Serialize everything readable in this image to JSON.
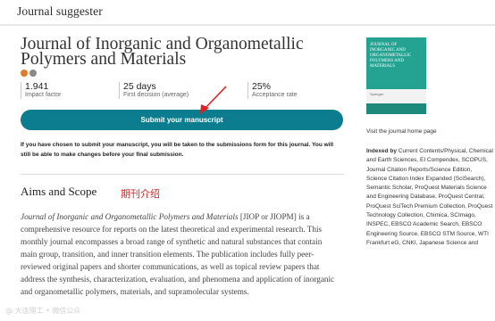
{
  "header": {
    "brand": "Journal suggester"
  },
  "journal": {
    "title": "Journal of Inorganic and Organometallic Polymers and Materials",
    "metrics": [
      {
        "value": "1.941",
        "label": "Impact factor"
      },
      {
        "value": "25 days",
        "label": "First decision (average)"
      },
      {
        "value": "25%",
        "label": "Acceptance rate"
      }
    ],
    "submit_label": "Submit your manuscript",
    "notice": "If you have chosen to submit your manuscript, you will be taken to the submissions form for this journal. You will still be able to make changes before your final submission."
  },
  "aims": {
    "heading": "Aims and Scope",
    "annotation": "期刊介绍",
    "journal_name": "Journal of Inorganic and Organometallic Polymers and Materials",
    "body": " [JIOP or JIOPM] is a comprehensive resource for reports on the latest theoretical and experimental research. This monthly journal encompasses a broad range of synthetic and natural substances that contain main group, transition, and inner transition elements. The publication includes fully peer-reviewed original papers and shorter communications, as well as topical review papers that address the synthesis, characterization, evaluation, and phenomena and application of inorganic and organometallic polymers, materials, and supramolecular systems."
  },
  "sidebar": {
    "cover_title": "Journal of Inorganic and Organometallic Polymers and Materials",
    "cover_logo": "Springer",
    "home_link": "Visit the journal home page",
    "indexed_label": "Indexed by",
    "indexed_text": " Current Contents/Physical, Chemical and Earth Sciences, EI Compendex, SCOPUS, Journal Citation Reports/Science Edition, Science Citation Index Expanded (SciSearch), Semantic Scholar, ProQuest Materials Science and Engineering Database, ProQuest Central, ProQuest SciTech Premium Collection, ProQuest Technology Collection, Chimica, SCImago, INSPEC, EBSCO Academic Search, EBSCO Engineering Source, EBSCO STM Source, WTI Frankfurt eG, CNKI, Japanese Science and"
  },
  "watermark": "@ 大连理工 • 微信公众"
}
